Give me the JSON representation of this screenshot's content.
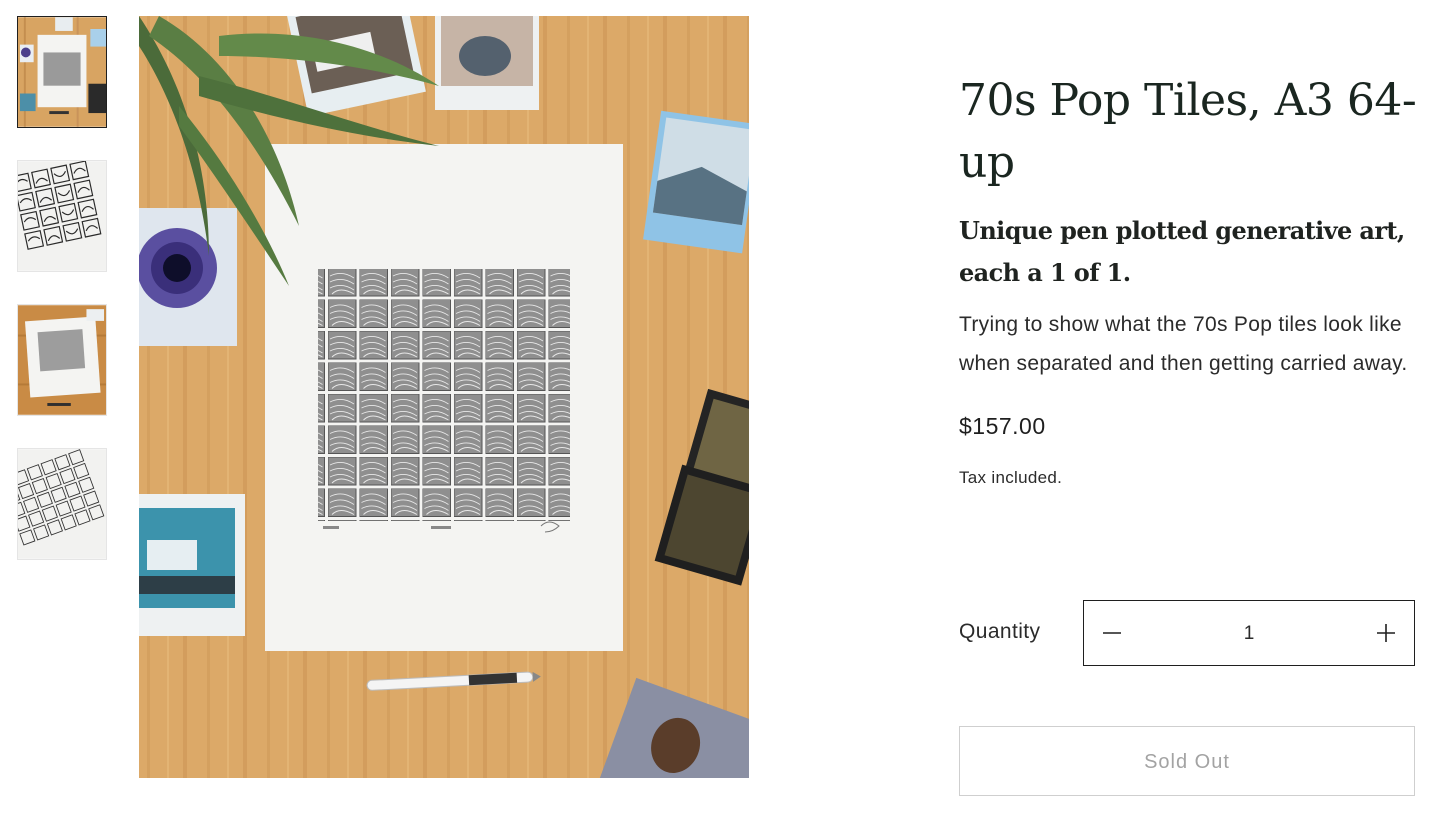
{
  "product": {
    "title": "70s Pop Tiles, A3 64-up",
    "subtitle": "Unique pen plotted generative art, each a 1 of 1.",
    "description": "Trying to show what the 70s Pop tiles look like when separated and then getting carried away.",
    "price": "$157.00",
    "tax_note": "Tax included."
  },
  "quantity": {
    "label": "Quantity",
    "value": "1"
  },
  "buy_button": {
    "label": "Sold Out"
  },
  "colors": {
    "title": "#1a2620",
    "wood": "#d9a865",
    "paper": "#f4f4f2",
    "border": "#1f1f1f"
  }
}
